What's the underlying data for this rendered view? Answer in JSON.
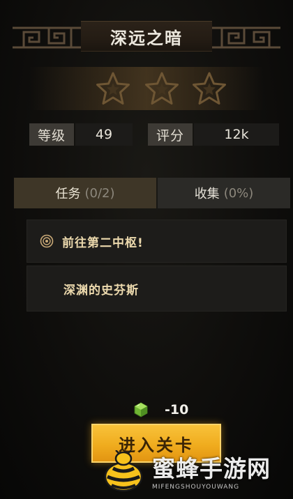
{
  "level": {
    "title": "深远之暗",
    "stars": {
      "earned": 0,
      "total": 3,
      "icon": "star-icon"
    }
  },
  "stats": {
    "level_label": "等级",
    "level_value": "49",
    "score_label": "评分",
    "score_value": "12k"
  },
  "tabs": [
    {
      "label": "任务",
      "count": "(0/2)",
      "active": true
    },
    {
      "label": "收集",
      "count": "(0%)",
      "active": false
    }
  ],
  "tasks": [
    {
      "text": "前往第二中枢!",
      "icon": "target-icon"
    },
    {
      "text": "深渊的史芬斯"
    }
  ],
  "cost": {
    "icon": "energy-crystal-icon",
    "value": "-10"
  },
  "enter_button": {
    "label": "进入关卡"
  },
  "watermark": {
    "text": "蜜蜂手游网",
    "subtext": "MIFENGSHOUYOUWANG"
  },
  "colors": {
    "accent_gold": "#f0ac1e",
    "panel_dark": "#1d1c1a",
    "tab_active": "#3e3627",
    "task_text": "#ecd9ad",
    "crystal_green": "#7cc43a"
  }
}
